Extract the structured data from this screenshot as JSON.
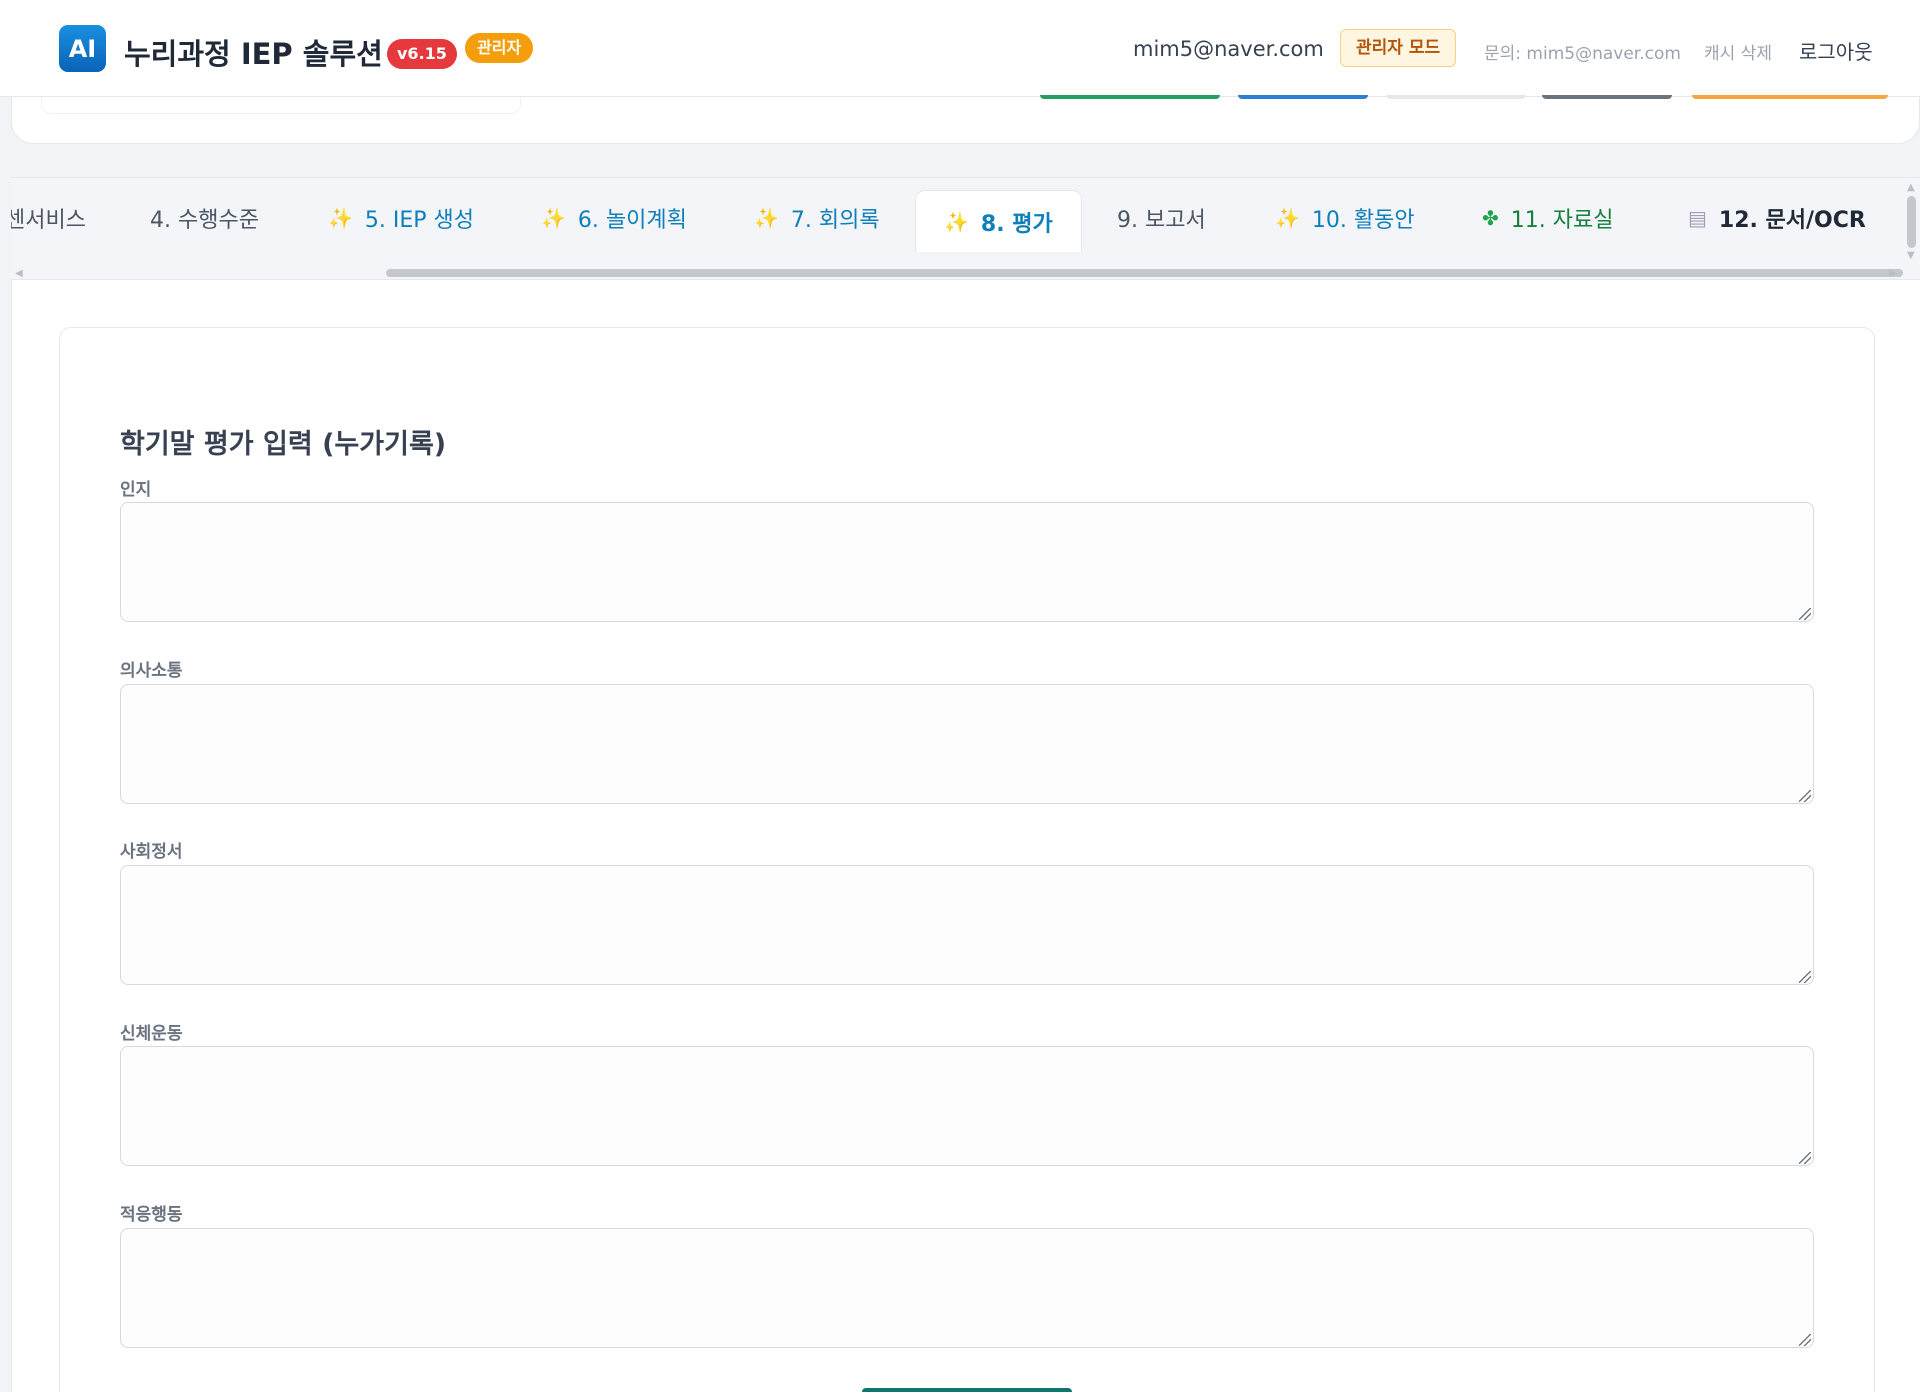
{
  "header": {
    "logo_text": "AI",
    "title": "누리과정 IEP 솔루션",
    "version": "v6.15",
    "role_badge": "관리자",
    "user_email": "mim5@naver.com",
    "admin_mode_label": "관리자 모드",
    "contact": "문의: mim5@naver.com",
    "cache_label": "캐시 삭제",
    "logout_label": "로그아웃"
  },
  "tabs": [
    {
      "label": "센서비스",
      "icon": "",
      "color": "#4b5563"
    },
    {
      "label": "4. 수행수준",
      "icon": "",
      "color": "#4b5563"
    },
    {
      "label": "5. IEP 생성",
      "icon": "sparkle-icon",
      "color": "#0e7fb8"
    },
    {
      "label": "6. 놀이계획",
      "icon": "sparkle-icon",
      "color": "#0e7fb8"
    },
    {
      "label": "7. 회의록",
      "icon": "sparkle-icon",
      "color": "#0e7fb8"
    },
    {
      "label": "8. 평가",
      "icon": "sparkle-icon",
      "color": "#0e7fb8",
      "active": true
    },
    {
      "label": "9. 보고서",
      "icon": "",
      "color": "#4b5563"
    },
    {
      "label": "10. 활동안",
      "icon": "sparkle-icon",
      "color": "#0e7fb8"
    },
    {
      "label": "11. 자료실",
      "icon": "puzzle-icon",
      "color": "#15803d"
    },
    {
      "label": "12. 문서/OCR",
      "icon": "document-icon",
      "color": "#1f2937"
    }
  ],
  "form": {
    "title": "학기말 평가 입력 (누가기록)",
    "fields": [
      {
        "label": "인지",
        "value": ""
      },
      {
        "label": "의사소통",
        "value": ""
      },
      {
        "label": "사회정서",
        "value": ""
      },
      {
        "label": "신체운동",
        "value": ""
      },
      {
        "label": "적응행동",
        "value": ""
      }
    ]
  },
  "colors": {
    "brand": "#0a63b8",
    "version_badge": "#e5393d",
    "role_badge": "#f59e0b",
    "tab_accent": "#0e7fb8",
    "submit": "#0f766e"
  }
}
